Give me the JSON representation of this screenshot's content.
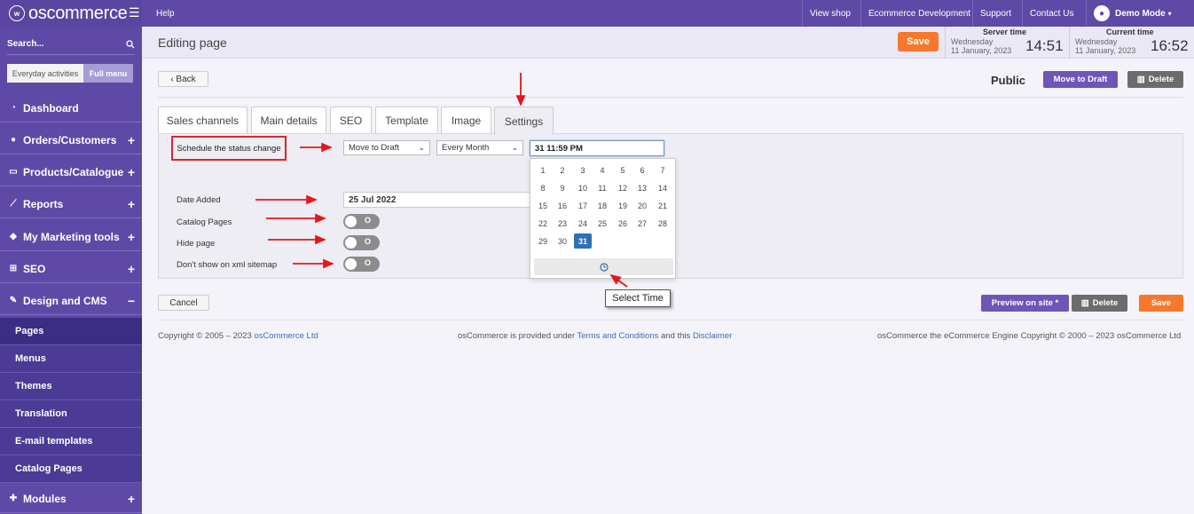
{
  "brand": {
    "logo_mark": "w",
    "name": "oscommerce"
  },
  "sidebar": {
    "search_label": "Search...",
    "menu_modes": [
      "Everyday activities",
      "Full menu"
    ],
    "items": [
      {
        "label": "Dashboard",
        "icon": "dashboard-icon",
        "expand": ""
      },
      {
        "label": "Orders/Customers",
        "icon": "users-icon",
        "expand": "+"
      },
      {
        "label": "Products/Catalogue",
        "icon": "folder-icon",
        "expand": "+"
      },
      {
        "label": "Reports",
        "icon": "chart-icon",
        "expand": "+"
      },
      {
        "label": "My Marketing tools",
        "icon": "tag-icon",
        "expand": "+"
      },
      {
        "label": "SEO",
        "icon": "sitemap-icon",
        "expand": "+"
      },
      {
        "label": "Design and CMS",
        "icon": "brush-icon",
        "expand": "−"
      },
      {
        "label": "Modules",
        "icon": "puzzle-icon",
        "expand": "+"
      }
    ],
    "design_sub": [
      "Pages",
      "Menus",
      "Themes",
      "Translation",
      "E-mail templates",
      "Catalog Pages"
    ]
  },
  "topbar": {
    "help": "Help",
    "view_shop": "View shop",
    "ecommerce_dev": "Ecommerce Development",
    "support": "Support",
    "contact": "Contact Us",
    "user": "Demo Mode"
  },
  "header": {
    "title": "Editing page",
    "save": "Save",
    "server_time_label": "Server time",
    "server_day": "Wednesday",
    "server_date": "11 January, 2023",
    "server_clock": "14:51",
    "current_time_label": "Current time",
    "current_day": "Wednesday",
    "current_date": "11 January, 2023",
    "current_clock": "16:52"
  },
  "actions": {
    "back": "‹ Back",
    "status": "Public",
    "move_to_draft": "Move to Draft",
    "delete": "Delete"
  },
  "tabs": [
    "Sales channels",
    "Main details",
    "SEO",
    "Template",
    "Image",
    "Settings"
  ],
  "settings": {
    "schedule_label": "Schedule the status change",
    "status_select": "Move to Draft",
    "repeat_select": "Every Month",
    "datetime_value": "31 11:59 PM",
    "date_added_label": "Date Added",
    "date_added_value": "25 Jul 2022",
    "catalog_pages_label": "Catalog Pages",
    "hide_page_label": "Hide page",
    "xml_sitemap_label": "Don't show on xml sitemap",
    "toggle_text": "O"
  },
  "calendar": {
    "weeks": [
      [
        "1",
        "2",
        "3",
        "4",
        "5",
        "6",
        "7"
      ],
      [
        "8",
        "9",
        "10",
        "11",
        "12",
        "13",
        "14"
      ],
      [
        "15",
        "16",
        "17",
        "18",
        "19",
        "20",
        "21"
      ],
      [
        "22",
        "23",
        "24",
        "25",
        "26",
        "27",
        "28"
      ],
      [
        "29",
        "30",
        "31"
      ]
    ],
    "selected": "31",
    "time_icon": "clock-icon"
  },
  "tooltip": "Select Time",
  "bottom": {
    "cancel": "Cancel",
    "preview": "Preview on site *",
    "delete": "Delete",
    "save": "Save"
  },
  "footer": {
    "copyright_pre": "Copyright © 2005 – 2023 ",
    "copyright_link": "osCommerce Ltd",
    "provided_pre": "osCommerce is provided under ",
    "terms": "Terms and Conditions",
    "provided_mid": " and this ",
    "disclaimer": "Disclaimer",
    "engine": "osCommerce the eCommerce Engine Copyright © 2000 – 2023 osCommerce Ltd"
  },
  "colors": {
    "brand": "#5e4aa6",
    "accent_orange": "#f7782c",
    "highlight_red": "#d9262b",
    "selected_day": "#2f6fb4"
  }
}
